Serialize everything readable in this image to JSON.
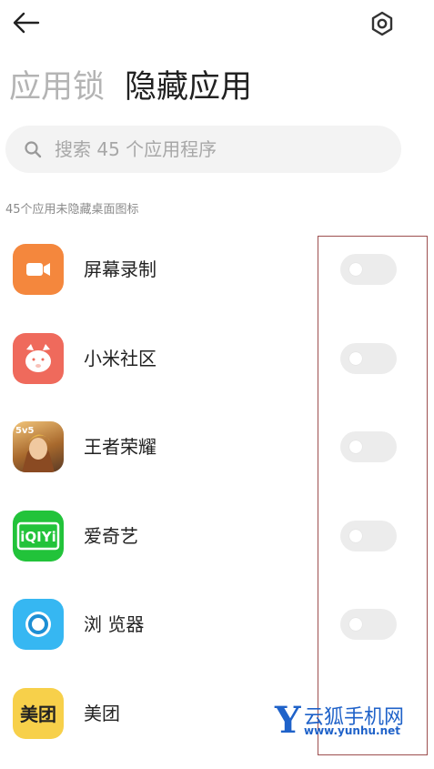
{
  "header": {
    "back_icon": "arrow-left-icon",
    "settings_icon": "gear-icon"
  },
  "tabs": [
    {
      "label": "应用锁",
      "active": false
    },
    {
      "label": "隐藏应用",
      "active": true
    }
  ],
  "search": {
    "placeholder": "搜索 45 个应用程序",
    "icon": "search-icon"
  },
  "subtitle": "45个应用未隐藏桌面图标",
  "apps": [
    {
      "name": "屏幕录制",
      "icon": "video-camera-icon",
      "color": "#f4873d",
      "hidden": false
    },
    {
      "name": "小米社区",
      "icon": "bunny-face-icon",
      "color": "#ef6a5c",
      "hidden": false
    },
    {
      "name": "王者荣耀",
      "icon": "game-hero-icon",
      "color": "#b5813f",
      "hidden": false
    },
    {
      "name": "爱奇艺",
      "icon": "iqiyi-logo-icon",
      "color": "#22c33a",
      "hidden": false
    },
    {
      "name": "浏 览器",
      "icon": "browser-ring-icon",
      "color": "#36b7f2",
      "hidden": false
    },
    {
      "name": "美团",
      "icon": "meituan-logo-icon",
      "color": "#f7d04a",
      "hidden": false
    }
  ],
  "app_logo_text": {
    "iqiyi": "iQIYi",
    "meituan": "美团",
    "game": "5v5"
  },
  "watermark": {
    "letter": "Y",
    "name": "云狐手机网",
    "url": "www.yunhu.net"
  }
}
